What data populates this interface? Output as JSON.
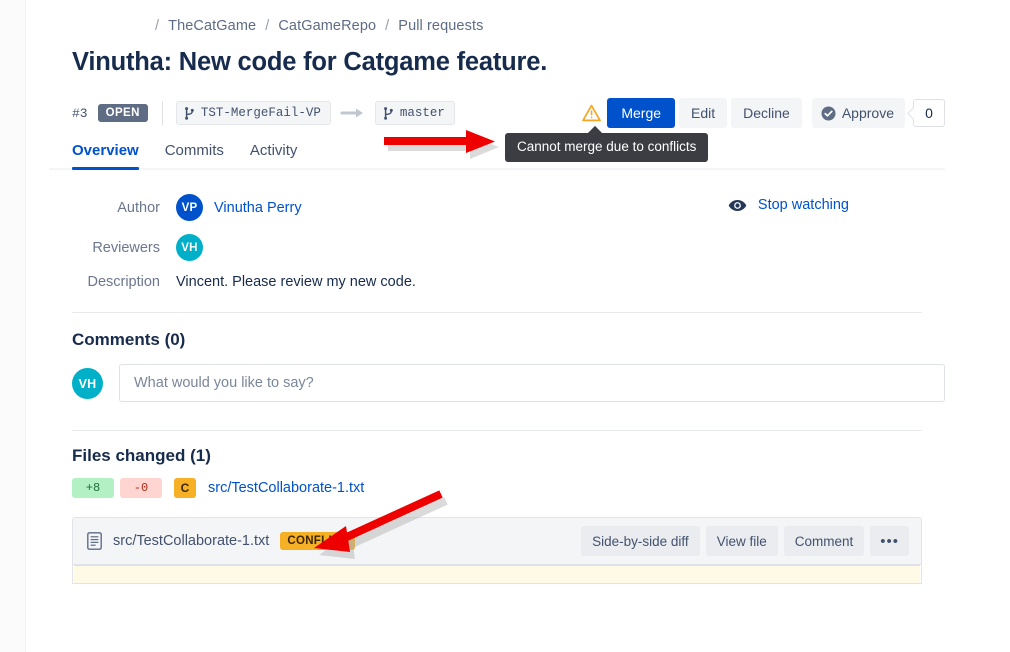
{
  "breadcrumb": {
    "separator": "/",
    "items": [
      "TheCatGame",
      "CatGameRepo",
      "Pull requests"
    ]
  },
  "page_title": "Vinutha: New code for Catgame feature.",
  "pull_request": {
    "number": "#3",
    "state": "OPEN",
    "source_branch": "TST-MergeFail-VP",
    "target_branch": "master",
    "branch_arrow": "→"
  },
  "actions": {
    "warning_icon": "warning-triangle-icon",
    "merge_label": "Merge",
    "edit_label": "Edit",
    "decline_label": "Decline",
    "approve_label": "Approve",
    "approve_count": "0"
  },
  "tooltip": {
    "text": "Cannot merge due to conflicts"
  },
  "tabs": [
    {
      "label": "Overview",
      "active": true
    },
    {
      "label": "Commits",
      "active": false
    },
    {
      "label": "Activity",
      "active": false
    }
  ],
  "meta": {
    "author_label": "Author",
    "author_initials": "VP",
    "author_name": "Vinutha Perry",
    "reviewers_label": "Reviewers",
    "reviewer_initials": "VH",
    "description_label": "Description",
    "description_text": "Vincent. Please review my new code."
  },
  "watch": {
    "label": "Stop watching",
    "icon": "eye-icon"
  },
  "comments": {
    "title": "Comments (0)",
    "avatar_initials": "VH",
    "placeholder": "What would you like to say?",
    "value": ""
  },
  "files_changed": {
    "title": "Files changed (1)",
    "additions": "+8",
    "deletions": "-0",
    "status_letter": "C",
    "file_name": "src/TestCollaborate-1.txt"
  },
  "diff_panel": {
    "file_icon": "document-icon",
    "file_name": "src/TestCollaborate-1.txt",
    "conflict_badge": "CONFLICT",
    "buttons": [
      "Side-by-side diff",
      "View file",
      "Comment"
    ],
    "more_label": "•••"
  },
  "colors": {
    "brand_blue": "#0052cc",
    "text_dark": "#172b4d",
    "text_muted": "#6b778c",
    "open_badge": "#5e6c84",
    "conflict_yellow": "#f5b025",
    "avatar_teal": "#00b0c8",
    "annotation_red": "#ee0000",
    "add_green": "#b3f0c3",
    "del_red": "#ffd5d2"
  }
}
